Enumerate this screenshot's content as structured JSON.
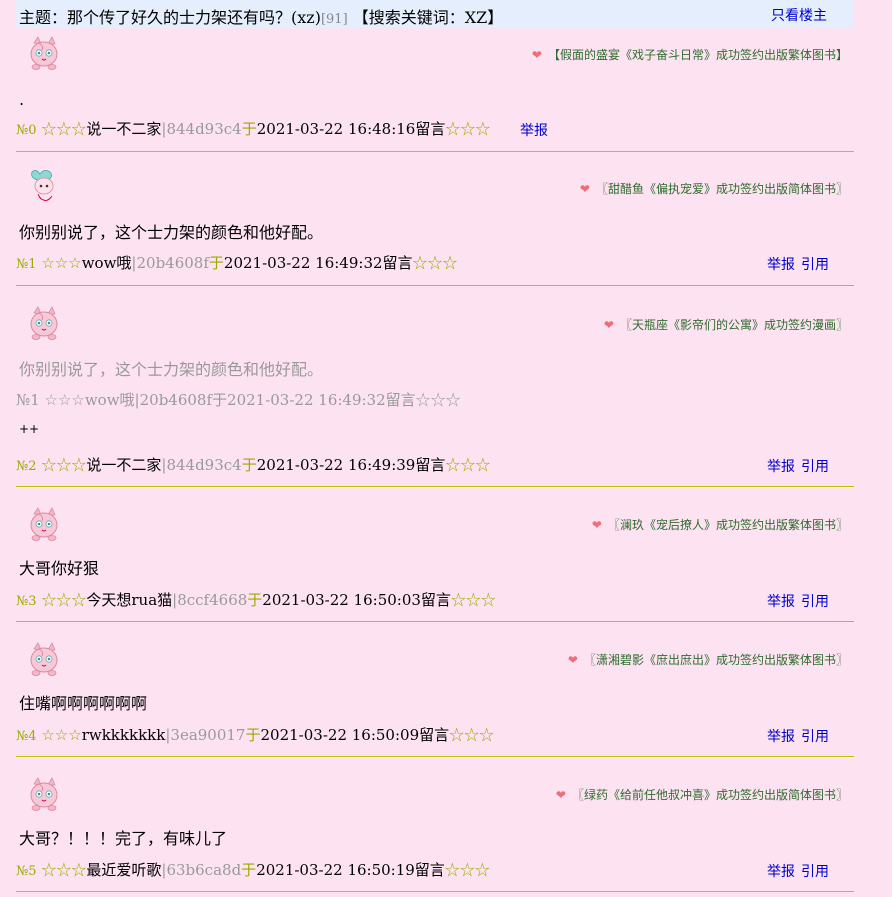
{
  "topic": {
    "label": "主题：",
    "title": "那个传了好久的士力架还有吗？(xz)",
    "count": "[91]",
    "keyword": "【搜索关键词：XZ】",
    "only_op": "只看楼主"
  },
  "actions": {
    "report": "举报",
    "quote": "引用"
  },
  "posts": [
    {
      "sign": "【假面的盛宴《戏子奋斗日常》成功签约出版繁体图书】",
      "content": ".",
      "no": "№0",
      "stars_pre": "☆☆☆",
      "name": "说一不二家",
      "hash": "|844d93c4",
      "yu": "于",
      "time": "2021-03-22 16:48:16留言",
      "stars_post": "☆☆☆"
    },
    {
      "sign": "〖甜醋鱼《偏执宠爱》成功签约出版简体图书〗",
      "content": "你别别说了，这个士力架的颜色和他好配。",
      "no": "№1",
      "stars_pre": "☆☆☆",
      "name": "wow哦",
      "hash": "|20b4608f",
      "yu": "于",
      "time": "2021-03-22 16:49:32留言",
      "stars_post": "☆☆☆"
    },
    {
      "sign": "〖天瓶座《影帝们的公寓》成功签约漫画〗",
      "quote1": "你别别说了，这个士力架的颜色和他好配。",
      "quote2": "№1 ☆☆☆wow哦|20b4608f于2021-03-22 16:49:32留言☆☆☆",
      "content": "++",
      "no": "№2",
      "stars_pre": "☆☆☆",
      "name": "说一不二家",
      "hash": "|844d93c4",
      "yu": "于",
      "time": "2021-03-22 16:49:39留言",
      "stars_post": "☆☆☆"
    },
    {
      "sign": "〖澜玖《宠后撩人》成功签约出版繁体图书〗",
      "content": "大哥你好狠",
      "no": "№3",
      "stars_pre": "☆☆☆",
      "name": "今天想rua猫",
      "hash": "|8ccf4668",
      "yu": "于",
      "time": "2021-03-22 16:50:03留言",
      "stars_post": "☆☆☆"
    },
    {
      "sign": "〖潇湘碧影《庶出庶出》成功签约出版繁体图书〗",
      "content": "住嘴啊啊啊啊啊啊",
      "no": "№4",
      "stars_pre": "☆☆☆",
      "name": "rwkkkkkkk",
      "hash": "|3ea90017",
      "yu": "于",
      "time": "2021-03-22 16:50:09留言",
      "stars_post": "☆☆☆"
    },
    {
      "sign": "〖绿药《给前任他叔冲喜》成功签约出版简体图书〗",
      "content": "大哥？！！！完了，有味儿了",
      "no": "№5",
      "stars_pre": "☆☆☆",
      "name": "最近爱听歌",
      "hash": "|63b6ca8d",
      "yu": "于",
      "time": "2021-03-22 16:50:19留言",
      "stars_post": "☆☆☆"
    }
  ]
}
